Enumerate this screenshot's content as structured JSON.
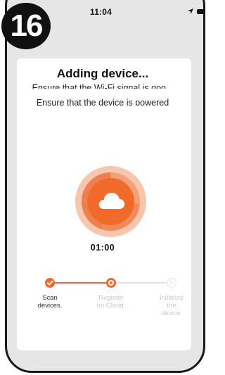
{
  "step_number": "16",
  "status_bar": {
    "time": "11:04"
  },
  "screen": {
    "title": "Adding device...",
    "tips": [
      "Ensure that the Wi-Fi signal is goo...",
      "Ensure that the device is powered"
    ],
    "timer": "01:00",
    "accent_color": "#F26A2A",
    "progress_steps": [
      {
        "label": "Scan\ndevices.",
        "state": "done"
      },
      {
        "label": "Register\non Cloud.",
        "state": "active"
      },
      {
        "label": "Initialize\nthe\ndevice.",
        "state": "pending"
      }
    ]
  }
}
